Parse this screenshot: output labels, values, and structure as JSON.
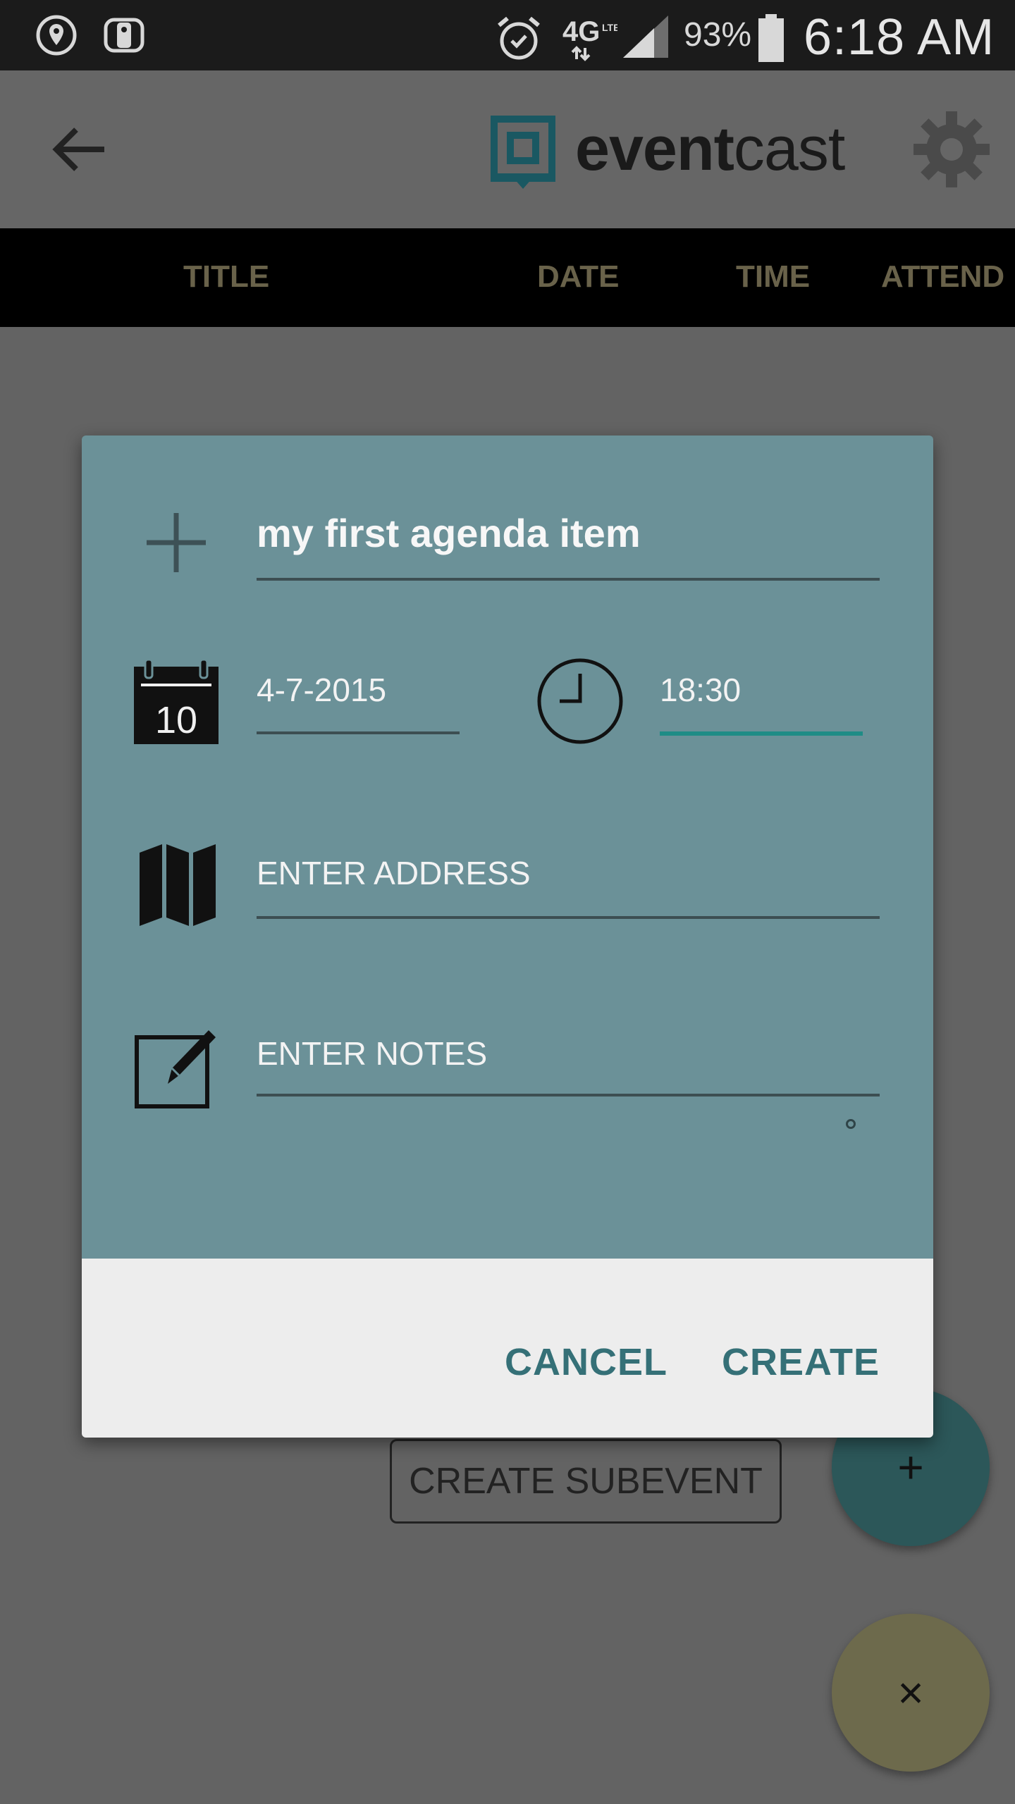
{
  "status_bar": {
    "battery_percent": "93%",
    "time": "6:18 AM",
    "icons": [
      "location-icon",
      "remote-icon",
      "alarm-icon",
      "network-4g-lte-icon",
      "signal-icon",
      "battery-icon"
    ]
  },
  "app_bar": {
    "brand_bold": "event",
    "brand_light": "cast",
    "icons": [
      "back-arrow-icon",
      "logo-icon",
      "settings-gear-icon"
    ]
  },
  "table_header": {
    "columns": [
      "TITLE",
      "DATE",
      "TIME",
      "ATTEND"
    ]
  },
  "background": {
    "create_subevent_label": "CREATE SUBEVENT",
    "fab_add_symbol": "+",
    "fab_close_symbol": "×"
  },
  "dialog": {
    "title_value": "my first agenda item",
    "date_value": "4-7-2015",
    "calendar_day": "10",
    "time_value": "18:30",
    "address_placeholder": "ENTER ADDRESS",
    "notes_placeholder": "ENTER NOTES",
    "cancel_label": "CANCEL",
    "create_label": "CREATE"
  },
  "colors": {
    "dialog_body": "#6b9198",
    "accent_teal": "#357077",
    "time_underline": "#1f8c86",
    "header_text": "#69624a"
  }
}
